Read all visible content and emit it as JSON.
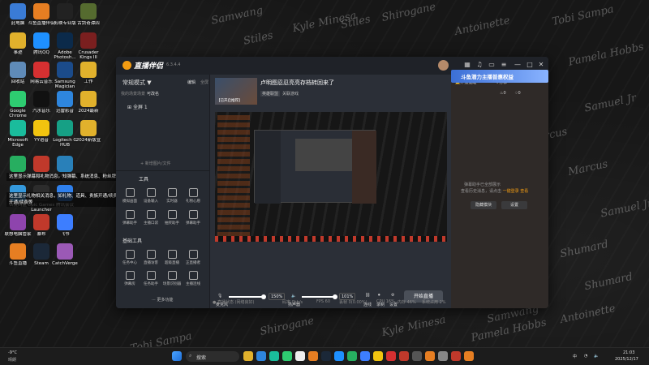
{
  "colors": {
    "accent": "#f39c12",
    "window_bg": "#2a2e36",
    "taskbar_bg": "#1c1c1c"
  },
  "desktop": {
    "icons": [
      {
        "label": "此电脑",
        "icon": "computer-icon",
        "color": "#3a7bd5"
      },
      {
        "label": "斗鱼直播伴侣",
        "icon": "douyu-icon",
        "color": "#e67e22"
      },
      {
        "label": "剪映专业版",
        "icon": "capcut-icon",
        "color": "#222222"
      },
      {
        "label": "古剑奇谭四",
        "icon": "game-icon",
        "color": "#556b2f"
      },
      {
        "label": "事迹",
        "icon": "folder-icon",
        "color": "#e1b12c"
      },
      {
        "label": "腾讯QQ",
        "icon": "qq-icon",
        "color": "#1e90ff"
      },
      {
        "label": "Adobe Photosh...",
        "icon": "photoshop-icon",
        "color": "#0b2a4a"
      },
      {
        "label": "Crusader Kings III",
        "icon": "ck3-icon",
        "color": "#7a1f1f"
      },
      {
        "label": "回收站",
        "icon": "recycle-bin-icon",
        "color": "#5f8bb8"
      },
      {
        "label": "网易云音乐",
        "icon": "netease-music-icon",
        "color": "#d63031"
      },
      {
        "label": "Samsung Magician",
        "icon": "samsung-icon",
        "color": "#1b4b8a"
      },
      {
        "label": "工作",
        "icon": "folder-icon",
        "color": "#e1b12c"
      },
      {
        "label": "Google Chrome",
        "icon": "chrome-icon",
        "color": "#2ecc71"
      },
      {
        "label": "汽水音乐",
        "icon": "qishui-icon",
        "color": "#111111"
      },
      {
        "label": "迅雷影音",
        "icon": "xunlei-icon",
        "color": "#2e86de"
      },
      {
        "label": "2024最新",
        "icon": "folder-icon",
        "color": "#e1b12c"
      },
      {
        "label": "Microsoft Edge",
        "icon": "edge-icon",
        "color": "#1abc9c"
      },
      {
        "label": "YY语音",
        "icon": "yy-icon",
        "color": "#f1c40f"
      },
      {
        "label": "Logitech G HUB",
        "icon": "ghub-icon",
        "color": "#16a085"
      },
      {
        "label": "2024新版宣",
        "icon": "folder-icon",
        "color": "#e1b12c"
      },
      {
        "label": "微信",
        "icon": "wechat-icon",
        "color": "#27ae60"
      },
      {
        "label": "EA",
        "icon": "ea-icon",
        "color": "#c0392b"
      },
      {
        "label": "Cities2",
        "icon": "cities-icon",
        "color": "#2980b9"
      },
      {
        "label": "百度网盘",
        "icon": "baidu-pan-icon",
        "color": "#3498db"
      },
      {
        "label": "Epic Games Launcher",
        "icon": "epic-icon",
        "color": "#2c2c2c"
      },
      {
        "label": "腾讯会议",
        "icon": "tencent-meeting-icon",
        "color": "#2f80ed"
      },
      {
        "label": "联想电脑管家",
        "icon": "lenovo-icon",
        "color": "#8e44ad"
      },
      {
        "label": "暴布",
        "icon": "app-icon",
        "color": "#c0392b"
      },
      {
        "label": "飞书",
        "icon": "feishu-icon",
        "color": "#3d7eff"
      },
      {
        "label": "斗鱼直播",
        "icon": "douyu-icon",
        "color": "#e67e22"
      },
      {
        "label": "Steam",
        "icon": "steam-icon",
        "color": "#1b2838"
      },
      {
        "label": "CatchVerge",
        "icon": "catchverge-icon",
        "color": "#9b59b6"
      }
    ],
    "tooltip": {
      "line1": "这里显示弹幕和礼物消息，知弹幕、系统消息、粉丝牌升级等",
      "line2": "这里显示礼物相关消息，如礼物、道具、贵族开通/续费、贴粉",
      "line3": "开通/续费等"
    },
    "signatures": [
      "Samwang",
      "Kyle Minesa",
      "Shirogane",
      "Antoinette",
      "Tobi Sampa",
      "Stiles",
      "Pamela Hobbs",
      "Samuel Jr",
      "Marcus",
      "Shumard"
    ]
  },
  "window": {
    "title": "直播伴侣",
    "version": "6.3.4.4",
    "left": {
      "mode": "常规模式 ▼",
      "edit": "编辑",
      "all": "全屏",
      "tabs": [
        "我的场景",
        "场景",
        "可改名"
      ],
      "scene": "全屏 1",
      "add_scene": "+ 新增图片/文件",
      "section_tools": "工具",
      "tools_row1": [
        "模拟画面",
        "设备输入",
        "实时器",
        "礼物心愿"
      ],
      "tools_row2": [
        "弹幕助手",
        "主播口袋",
        "抽奖助手",
        "弹幕助手"
      ],
      "section_basic": "基础工具",
      "basic_row1": [
        "任务中心",
        "直播访客",
        "超级直播",
        "正直播者"
      ],
      "basic_row2": [
        "弹幕房",
        "任务助手",
        "场景识别器",
        "主播连线"
      ],
      "more": "··· 更多功能"
    },
    "center": {
      "room_title": "卢明图忍忍亮亮存档转回来了",
      "category": "英雄联盟",
      "tag": "关联游戏",
      "cover_text": "【已开启推荐】",
      "mic_label": "麦克风",
      "mic_value": "150%",
      "speaker_label": "扬声器",
      "speaker_value": "101%",
      "actions": [
        "连线",
        "录制",
        "设置"
      ],
      "start_button": "开始直播",
      "stats": [
        "直播时长 00:00:00",
        "码率 0kb/s",
        "FPS 60",
        "丢帧 0(0.00%)",
        "CPU 16%",
        "内存 46%",
        "系统占用 2%"
      ],
      "status": "● 直播状态 (网络良好)"
    },
    "right": {
      "go_live": "开播提醒",
      "share": "分享",
      "hot": "0",
      "gift": "0",
      "banner": "斗鱼潜力主播普惠权益",
      "msg1": "弹幕助手已全部展示",
      "msg2": "查看历史消息，请点击",
      "msg_link": "一键登录",
      "msg_tail": "查看",
      "btn_hide": "隐藏模块",
      "btn_set": "设置"
    }
  },
  "taskbar": {
    "weather_temp": "-9°C",
    "weather_desc": "晴朗",
    "search_placeholder": "搜索",
    "time": "21:03",
    "date": "2025/12/17",
    "ime": "中",
    "apps": [
      "explorer-icon",
      "store-icon",
      "edge-icon",
      "chrome-icon",
      "nv-icon",
      "douyu-icon",
      "steam-icon",
      "qq-icon",
      "wechat-icon",
      "feishu-icon",
      "yy-icon",
      "music-icon",
      "app-icon",
      "app-icon",
      "app-icon",
      "app-icon",
      "app-icon",
      "app-icon"
    ]
  }
}
